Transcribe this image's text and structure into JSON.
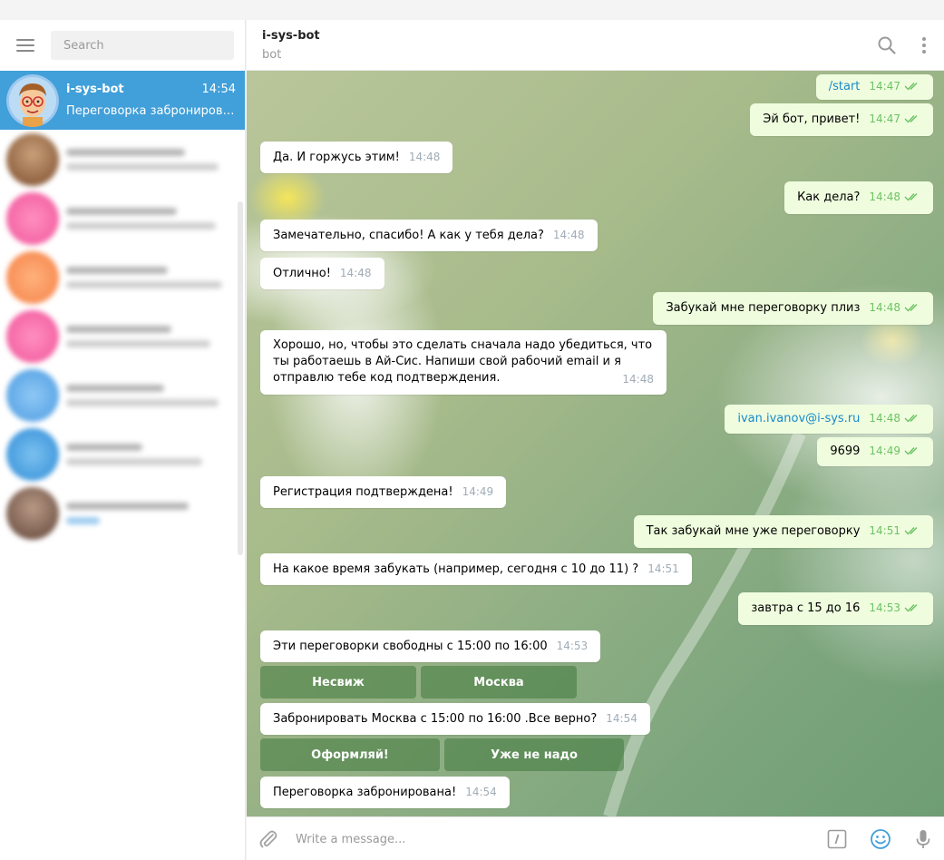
{
  "sidebar": {
    "search_placeholder": "Search",
    "active_chat": {
      "name": "i-sys-bot",
      "time": "14:54",
      "preview": "Переговорка забронирована!"
    }
  },
  "header": {
    "peer_name": "i-sys-bot",
    "peer_status": "bot"
  },
  "messages": [
    {
      "dir": "out",
      "text": "/start",
      "time": "14:47"
    },
    {
      "dir": "out",
      "text": "Эй бот, привет!",
      "time": "14:47"
    },
    {
      "dir": "in",
      "text": "Да. И горжусь этим!",
      "time": "14:48"
    },
    {
      "dir": "out",
      "text": "Как дела?",
      "time": "14:48"
    },
    {
      "dir": "in",
      "text": "Замечательно, спасибо! А как у тебя дела?",
      "time": "14:48"
    },
    {
      "dir": "in",
      "text": "Отлично!",
      "time": "14:48"
    },
    {
      "dir": "out",
      "text": "Забукай мне переговорку плиз",
      "time": "14:48"
    },
    {
      "dir": "in",
      "text": "Хорошо, но, чтобы это сделать сначала надо убедиться, что ты работаешь в Ай-Сис. Напиши свой рабочий email и я отправлю тебе код подтверждения.",
      "time": "14:48"
    },
    {
      "dir": "out",
      "text": "ivan.ivanov@i-sys.ru",
      "time": "14:48"
    },
    {
      "dir": "out",
      "text": "9699",
      "time": "14:49"
    },
    {
      "dir": "in",
      "text": "Регистрация подтверждена!",
      "time": "14:49"
    },
    {
      "dir": "out",
      "text": "Так забукай мне уже переговорку",
      "time": "14:51"
    },
    {
      "dir": "in",
      "text": "На какое время забукать (например, сегодня с 10 до 11) ?",
      "time": "14:51"
    },
    {
      "dir": "out",
      "text": "завтра с 15 до 16",
      "time": "14:53"
    },
    {
      "dir": "in",
      "text": "Эти переговорки свободны с 15:00 по 16:00",
      "time": "14:53"
    },
    {
      "dir": "in",
      "text": "Забронировать Москва с 15:00 по 16:00 .Все верно?",
      "time": "14:54"
    },
    {
      "dir": "in",
      "text": "Переговорка забронирована!",
      "time": "14:54"
    }
  ],
  "keyboards": {
    "rooms": [
      "Несвиж",
      "Москва"
    ],
    "confirm": [
      "Оформляй!",
      "Уже не надо"
    ]
  },
  "composer": {
    "placeholder": "Write a message..."
  },
  "colors": {
    "accent": "#419fd9",
    "out_bubble": "#effdde",
    "tick": "#6dc264",
    "link": "#168acd"
  }
}
